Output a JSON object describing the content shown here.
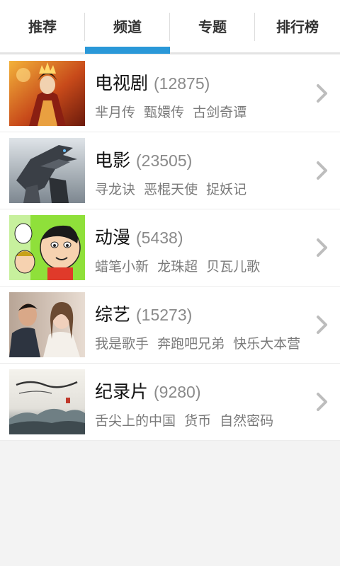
{
  "tabs": [
    {
      "label": "推荐",
      "active": false
    },
    {
      "label": "频道",
      "active": true
    },
    {
      "label": "专题",
      "active": false
    },
    {
      "label": "排行榜",
      "active": false
    }
  ],
  "channels": [
    {
      "name": "电视剧",
      "count": "(12875)",
      "shows": [
        "芈月传",
        "甄嬛传",
        "古剑奇谭"
      ],
      "thumb": "tv-drama-poster"
    },
    {
      "name": "电影",
      "count": "(23505)",
      "shows": [
        "寻龙诀",
        "恶棍天使",
        "捉妖记"
      ],
      "thumb": "movie-poster"
    },
    {
      "name": "动漫",
      "count": "(5438)",
      "shows": [
        "蜡笔小新",
        "龙珠超",
        "贝瓦儿歌"
      ],
      "thumb": "anime-poster"
    },
    {
      "name": "综艺",
      "count": "(15273)",
      "shows": [
        "我是歌手",
        "奔跑吧兄弟",
        "快乐大本营"
      ],
      "thumb": "variety-poster"
    },
    {
      "name": "纪录片",
      "count": "(9280)",
      "shows": [
        "舌尖上的中国",
        "货币",
        "自然密码"
      ],
      "thumb": "documentary-poster"
    }
  ],
  "colors": {
    "accent": "#2a98d8",
    "chevron": "#bdbdbd"
  }
}
